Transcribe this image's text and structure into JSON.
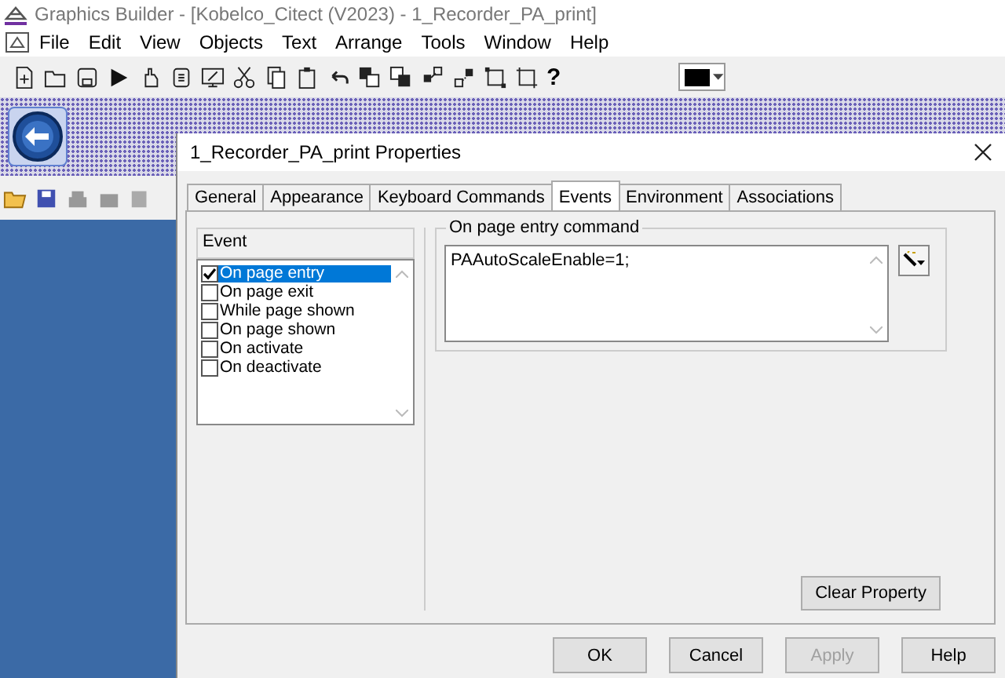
{
  "window": {
    "title": "Graphics Builder - [Kobelco_Citect (V2023) - 1_Recorder_PA_print]"
  },
  "menu": [
    "File",
    "Edit",
    "View",
    "Objects",
    "Text",
    "Arrange",
    "Tools",
    "Window",
    "Help"
  ],
  "toolbar": {
    "help_glyph": "?"
  },
  "dialog": {
    "title": "1_Recorder_PA_print Properties",
    "tabs": [
      {
        "label": "General",
        "selected": false
      },
      {
        "label": "Appearance",
        "selected": false
      },
      {
        "label": "Keyboard Commands",
        "selected": false
      },
      {
        "label": "Events",
        "selected": true
      },
      {
        "label": "Environment",
        "selected": false
      },
      {
        "label": "Associations",
        "selected": false
      }
    ],
    "event_header": "Event",
    "events": [
      {
        "label": "On page entry",
        "checked": true,
        "selected": true
      },
      {
        "label": "On page exit",
        "checked": false,
        "selected": false
      },
      {
        "label": "While page shown",
        "checked": false,
        "selected": false
      },
      {
        "label": "On page shown",
        "checked": false,
        "selected": false
      },
      {
        "label": "On activate",
        "checked": false,
        "selected": false
      },
      {
        "label": "On deactivate",
        "checked": false,
        "selected": false
      }
    ],
    "command_group": "On page entry command",
    "command_value": "PAAutoScaleEnable=1;",
    "clear_button": "Clear Property",
    "buttons": [
      {
        "label": "OK",
        "disabled": false
      },
      {
        "label": "Cancel",
        "disabled": false
      },
      {
        "label": "Apply",
        "disabled": true
      },
      {
        "label": "Help",
        "disabled": false
      }
    ]
  }
}
